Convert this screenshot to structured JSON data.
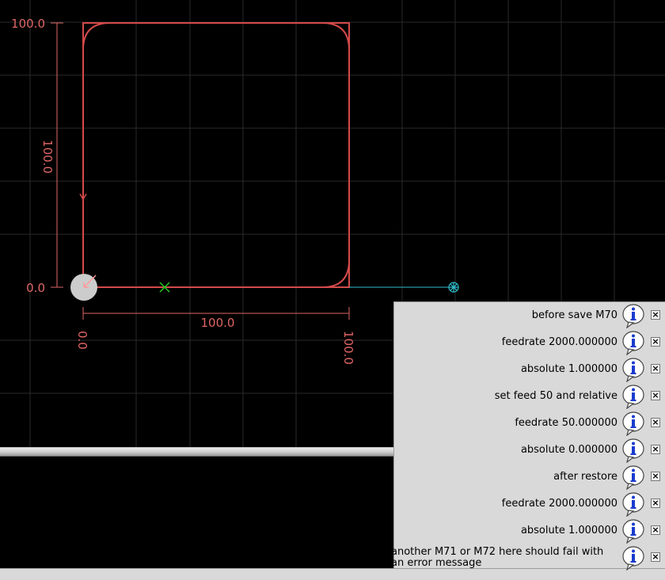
{
  "preview": {
    "dimensions": {
      "y_top": "100.0",
      "y_bottom": "0.0",
      "y_span": "100.0",
      "x_left": "0.0",
      "x_right": "100.0",
      "x_span": "100.0"
    },
    "colors": {
      "toolpath": "#d44a4a",
      "dimension": "#e06666",
      "traverse": "#2fc0d0",
      "grid": "#2a2a2a",
      "origin_marker": "#cccccc",
      "current_marker": "#22cc22"
    }
  },
  "notifications": [
    {
      "text": "before save M70"
    },
    {
      "text": "feedrate  2000.000000"
    },
    {
      "text": "absolute 1.000000"
    },
    {
      "text": "set feed 50 and relative"
    },
    {
      "text": "feedrate  50.000000"
    },
    {
      "text": "absolute 0.000000"
    },
    {
      "text": "after restore"
    },
    {
      "text": "feedrate  2000.000000"
    },
    {
      "text": "absolute 1.000000"
    },
    {
      "text": "another M71 or M72 here should fail with an error message"
    }
  ],
  "icons": {
    "info": "info-icon",
    "close": "close-icon",
    "close_glyph": "×"
  }
}
